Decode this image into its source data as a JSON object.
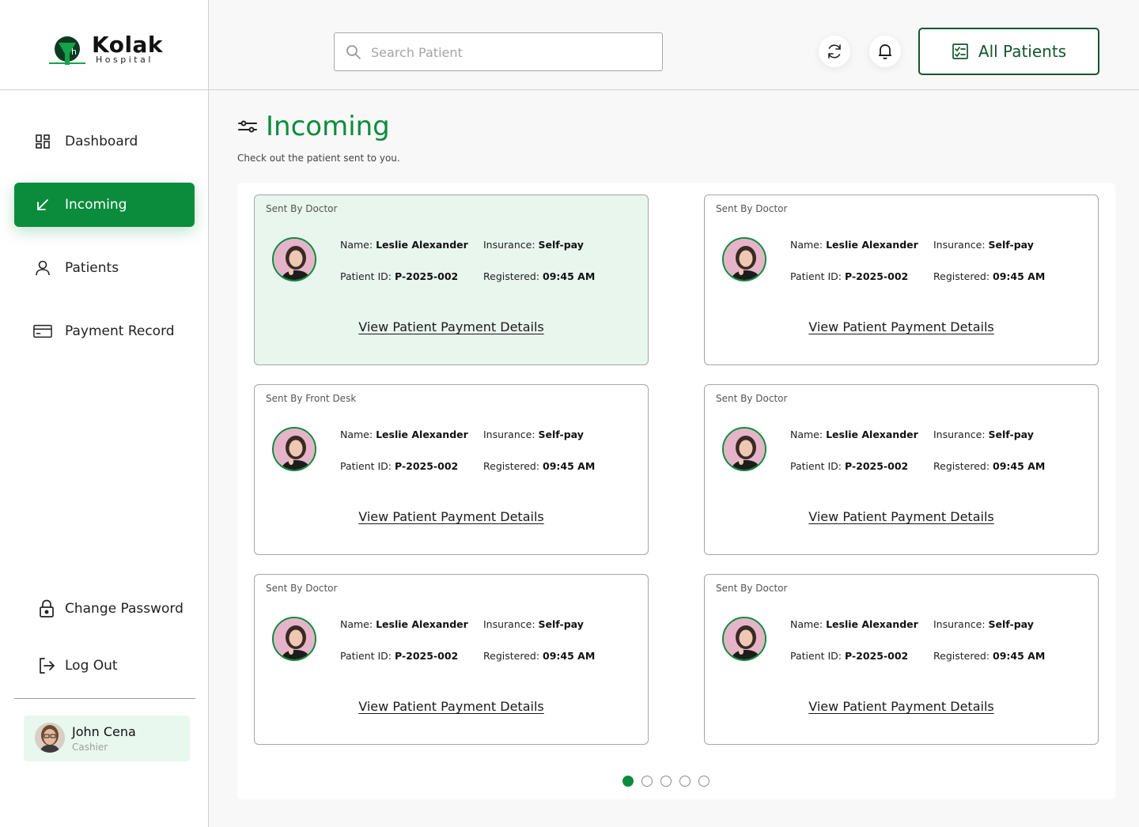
{
  "brand": {
    "name": "Kolak",
    "sub": "Hospital",
    "mark_letter": "h",
    "primary_color": "#0a8c3c",
    "dark_green": "#14562e"
  },
  "sidebar": {
    "items": [
      {
        "label": "Dashboard",
        "icon": "grid-icon",
        "active": false
      },
      {
        "label": "Incoming",
        "icon": "arrow-down-left-icon",
        "active": true
      },
      {
        "label": "Patients",
        "icon": "user-icon",
        "active": false
      },
      {
        "label": "Payment Record",
        "icon": "card-icon",
        "active": false
      }
    ],
    "change_password": "Change Password",
    "logout": "Log Out",
    "user": {
      "name": "John Cena",
      "role": "Cashier"
    }
  },
  "topbar": {
    "search_placeholder": "Search Patient",
    "all_patients_label": "All Patients"
  },
  "page": {
    "title": "Incoming",
    "subtitle": "Check out the patient sent to you."
  },
  "cards": [
    {
      "sent_by": "Sent By Doctor",
      "name_label": "Name:",
      "name": "Leslie Alexander",
      "insurance_label": "Insurance:",
      "insurance": "Self-pay",
      "id_label": "Patient ID:",
      "patient_id": "P-2025-002",
      "reg_label": "Registered:",
      "registered": "09:45 AM",
      "link": "View Patient Payment  Details",
      "highlighted": true
    },
    {
      "sent_by": "Sent By Doctor",
      "name_label": "Name:",
      "name": "Leslie Alexander",
      "insurance_label": "Insurance:",
      "insurance": "Self-pay",
      "id_label": "Patient ID:",
      "patient_id": "P-2025-002",
      "reg_label": "Registered:",
      "registered": "09:45 AM",
      "link": "View Patient Payment  Details",
      "highlighted": false
    },
    {
      "sent_by": "Sent By Front Desk",
      "name_label": "Name:",
      "name": "Leslie Alexander",
      "insurance_label": "Insurance:",
      "insurance": "Self-pay",
      "id_label": "Patient ID:",
      "patient_id": "P-2025-002",
      "reg_label": "Registered:",
      "registered": "09:45 AM",
      "link": "View Patient Payment  Details",
      "highlighted": false
    },
    {
      "sent_by": "Sent By Doctor",
      "name_label": "Name:",
      "name": "Leslie Alexander",
      "insurance_label": "Insurance:",
      "insurance": "Self-pay",
      "id_label": "Patient ID:",
      "patient_id": "P-2025-002",
      "reg_label": "Registered:",
      "registered": "09:45 AM",
      "link": "View Patient Payment  Details",
      "highlighted": false
    },
    {
      "sent_by": "Sent By Doctor",
      "name_label": "Name:",
      "name": "Leslie Alexander",
      "insurance_label": "Insurance:",
      "insurance": "Self-pay",
      "id_label": "Patient ID:",
      "patient_id": "P-2025-002",
      "reg_label": "Registered:",
      "registered": "09:45 AM",
      "link": "View Patient Payment  Details",
      "highlighted": false
    },
    {
      "sent_by": "Sent By Doctor",
      "name_label": "Name:",
      "name": "Leslie Alexander",
      "insurance_label": "Insurance:",
      "insurance": "Self-pay",
      "id_label": "Patient ID:",
      "patient_id": "P-2025-002",
      "reg_label": "Registered:",
      "registered": "09:45 AM",
      "link": "View Patient Payment  Details",
      "highlighted": false
    }
  ],
  "pagination": {
    "total_pages": 5,
    "current_page": 1
  }
}
